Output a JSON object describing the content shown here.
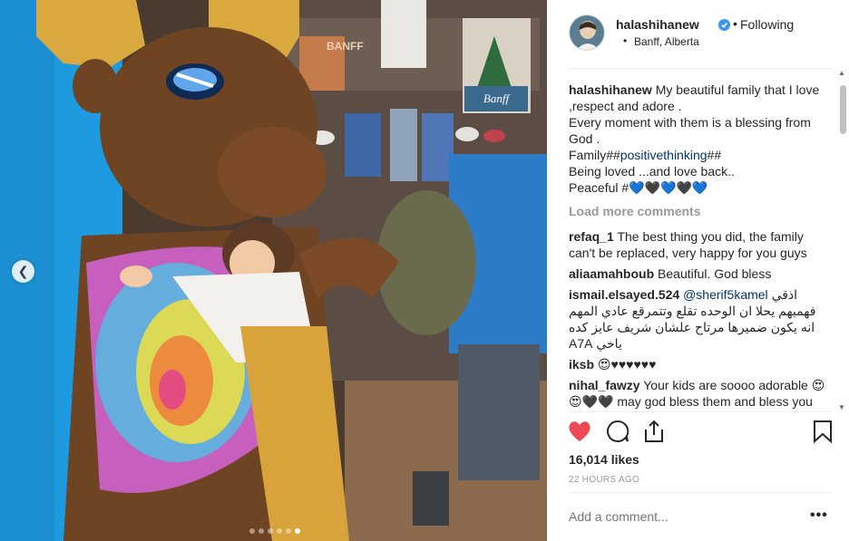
{
  "post": {
    "username": "halashihanew",
    "follow_label": "Following",
    "location": "Banff, Alberta",
    "likes": "16,014 likes",
    "time": "22 HOURS AGO",
    "add_comment_placeholder": "Add a comment...",
    "more_label": "•••"
  },
  "caption": {
    "username": "halashihanew",
    "lines": [
      "My beautiful family that I love ,respect and adore .",
      "Every moment with them is a blessing from God .",
      "Family##",
      "positivethinking",
      "##",
      "Being loved ...and love back..",
      "Peaceful #",
      "💙🖤💙🖤💙"
    ]
  },
  "load_more": "Load more comments",
  "comments": [
    {
      "user": "refaq_1",
      "text": "The best thing you did, the family can't be replaced, very happy for you guys"
    },
    {
      "user": "aliaamahboub",
      "text": "Beautiful. God bless"
    },
    {
      "user": "ismail.elsayed.524",
      "mention": "@sherif5kamel",
      "text": "اذقي فهميهم يحلا ان الوحده تقلع وتتمرقع عادي المهم انه يكون ضميرها مرتاح علشان شريف عايز كده ياخي A7A"
    },
    {
      "user": "iksb",
      "text": "😍♥♥♥♥♥♥"
    },
    {
      "user": "nihal_fawzy",
      "text": "Your kids are soooo adorable 😍😍🖤🖤 may god bless them and bless you too sweet heart😘😘🖤"
    }
  ],
  "photo": {
    "store_sign": "BANFF",
    "poster_text": "Banff"
  },
  "colors": {
    "verified": "#3897f0",
    "heart": "#ed4956",
    "link": "#003569"
  },
  "icons": [
    "heart-icon",
    "comment-icon",
    "share-icon",
    "bookmark-icon",
    "verified-icon",
    "chevron-left-icon"
  ]
}
